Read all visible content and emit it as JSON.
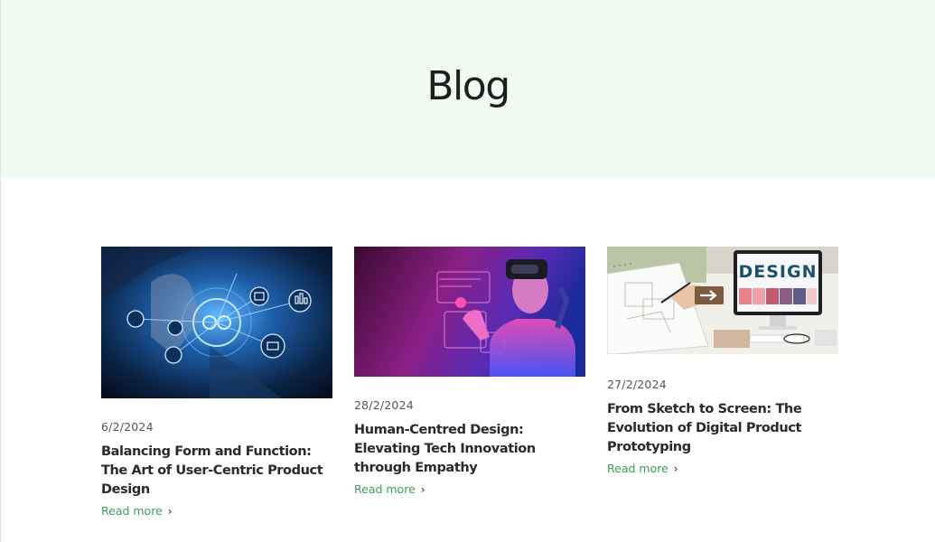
{
  "hero": {
    "title": "Blog"
  },
  "posts": [
    {
      "date": "6/2/2024",
      "title": "Balancing Form and Function: The Art of User-Centric Product Design",
      "link": "Read more",
      "image": "hand-touching-digital-interface-icons"
    },
    {
      "date": "28/2/2024",
      "title": "Human-Centred Design: Elevating Tech Innovation through Empathy",
      "link": "Read more",
      "image": "person-in-vr-headset-neon"
    },
    {
      "date": "27/2/2024",
      "title": "From Sketch to Screen: The Evolution of Digital Product Prototyping",
      "link": "Read more",
      "image": "sketch-to-design-monitor",
      "image_text": "DESIGN"
    }
  ],
  "colors": {
    "hero_bg": "#eefaf2",
    "link": "#3f9b5f",
    "text": "#2a2a2a"
  },
  "icons": {
    "read_more": "chevron-right-icon"
  }
}
